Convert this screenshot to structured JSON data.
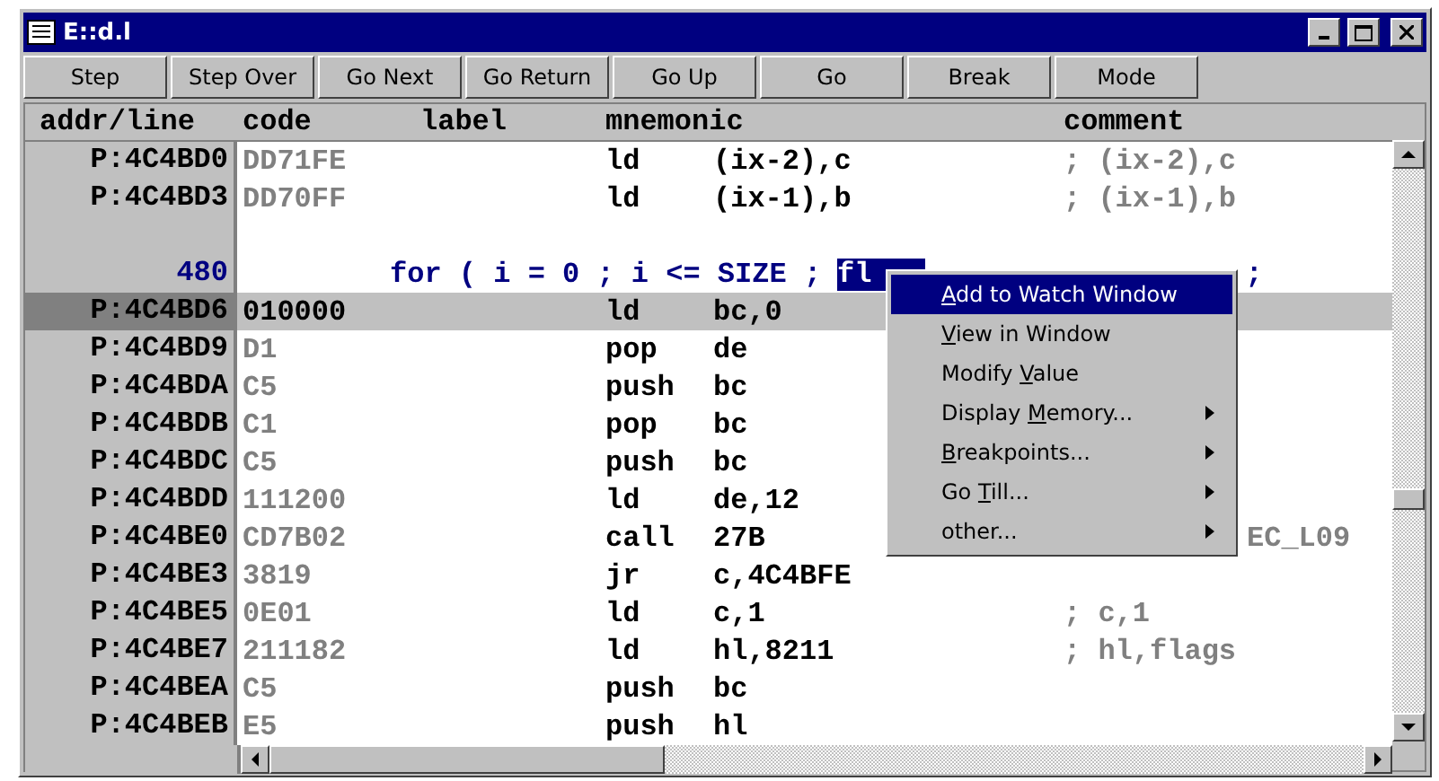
{
  "window": {
    "title": "E::d.l"
  },
  "toolbar": [
    "Step",
    "Step Over",
    "Go Next",
    "Go Return",
    "Go Up",
    "Go",
    "Break",
    "Mode"
  ],
  "columns": [
    "addr/line",
    "code",
    "label",
    "mnemonic",
    "comment"
  ],
  "rows": [
    {
      "kind": "instruction",
      "addr": "P:4C4BD0",
      "code": "DD71FE",
      "mnemonic": "ld",
      "operand": "(ix-2),c",
      "comment": "; (ix-2),c",
      "selected": false
    },
    {
      "kind": "instruction",
      "addr": "P:4C4BD3",
      "code": "DD70FF",
      "mnemonic": "ld",
      "operand": "(ix-1),b",
      "comment": "; (ix-1),b",
      "selected": false
    },
    {
      "kind": "blank"
    },
    {
      "kind": "source",
      "line": "480",
      "text": "for ( i = 0 ; i <= SIZE ;",
      "selection": "fl",
      "tail": ";"
    },
    {
      "kind": "instruction",
      "addr": "P:4C4BD6",
      "code": "010000",
      "mnemonic": "ld",
      "operand": "bc,0",
      "selected": true
    },
    {
      "kind": "instruction",
      "addr": "P:4C4BD9",
      "code": "D1",
      "mnemonic": "pop",
      "operand": "de",
      "selected": false
    },
    {
      "kind": "instruction",
      "addr": "P:4C4BDA",
      "code": "C5",
      "mnemonic": "push",
      "operand": "bc",
      "selected": false
    },
    {
      "kind": "instruction",
      "addr": "P:4C4BDB",
      "code": "C1",
      "mnemonic": "pop",
      "operand": "bc",
      "selected": false
    },
    {
      "kind": "instruction",
      "addr": "P:4C4BDC",
      "code": "C5",
      "mnemonic": "push",
      "operand": "bc",
      "selected": false
    },
    {
      "kind": "instruction",
      "addr": "P:4C4BDD",
      "code": "111200",
      "mnemonic": "ld",
      "operand": "de,12",
      "selected": false
    },
    {
      "kind": "instruction",
      "addr": "P:4C4BE0",
      "code": "CD7B02",
      "mnemonic": "call",
      "operand": "27B",
      "comment_tail": "EC_L09",
      "selected": false
    },
    {
      "kind": "instruction",
      "addr": "P:4C4BE3",
      "code": "3819",
      "mnemonic": "jr",
      "operand": "c,4C4BFE",
      "selected": false
    },
    {
      "kind": "instruction",
      "addr": "P:4C4BE5",
      "code": "0E01",
      "mnemonic": "ld",
      "operand": "c,1",
      "comment": "; c,1",
      "selected": false
    },
    {
      "kind": "instruction",
      "addr": "P:4C4BE7",
      "code": "211182",
      "mnemonic": "ld",
      "operand": "hl,8211",
      "comment": "; hl,flags",
      "selected": false
    },
    {
      "kind": "instruction",
      "addr": "P:4C4BEA",
      "code": "C5",
      "mnemonic": "push",
      "operand": "bc",
      "selected": false
    },
    {
      "kind": "instruction",
      "addr": "P:4C4BEB",
      "code": "E5",
      "mnemonic": "push",
      "operand": "hl",
      "selected": false
    }
  ],
  "context_menu": [
    {
      "key": "A",
      "after": "dd to Watch Window",
      "submenu": false,
      "selected": true
    },
    {
      "key": "V",
      "after": "iew in Window",
      "submenu": false,
      "selected": false
    },
    {
      "before": "Modify ",
      "key": "V",
      "after": "alue",
      "submenu": false,
      "selected": false
    },
    {
      "before": "Display ",
      "key": "M",
      "after": "emory...",
      "submenu": true,
      "selected": false
    },
    {
      "key": "B",
      "after": "reakpoints...",
      "submenu": true,
      "selected": false
    },
    {
      "before": "Go ",
      "key": "T",
      "after": "ill...",
      "submenu": true,
      "selected": false
    },
    {
      "before": "other...",
      "submenu": true,
      "selected": false
    }
  ]
}
